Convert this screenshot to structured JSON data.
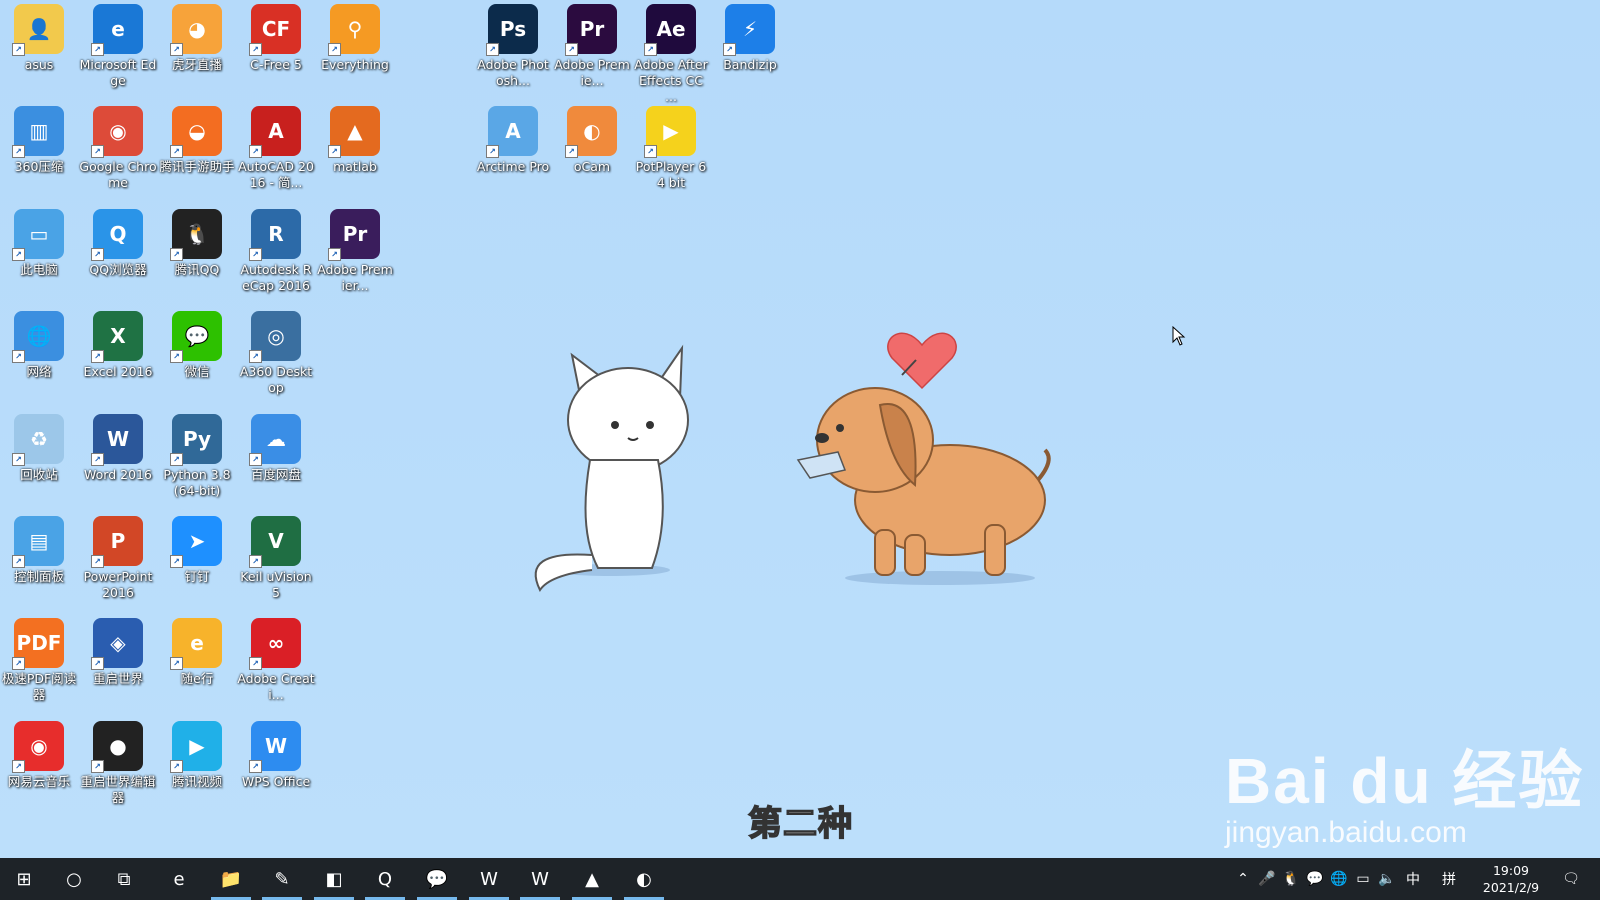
{
  "desktop": {
    "icons": [
      {
        "label": "asus",
        "glyph": "👤",
        "bg": "#f2c94c"
      },
      {
        "label": "Microsoft Edge",
        "glyph": "e",
        "bg": "#1a78d6"
      },
      {
        "label": "虎牙直播",
        "glyph": "◕",
        "bg": "#f7a33a"
      },
      {
        "label": "C-Free 5",
        "glyph": "CF",
        "bg": "#d93025"
      },
      {
        "label": "Everything",
        "glyph": "⚲",
        "bg": "#f59a23"
      },
      {
        "label": "Adobe Photosh...",
        "glyph": "Ps",
        "bg": "#0c2b4b"
      },
      {
        "label": "Adobe Premie...",
        "glyph": "Pr",
        "bg": "#2b0b3f"
      },
      {
        "label": "Adobe After Effects CC ...",
        "glyph": "Ae",
        "bg": "#1f0a3d"
      },
      {
        "label": "Bandizip",
        "glyph": "⚡",
        "bg": "#1d7fe8"
      },
      {
        "label": "360压缩",
        "glyph": "▥",
        "bg": "#3b8fe0"
      },
      {
        "label": "Google Chrome",
        "glyph": "◉",
        "bg": "#dd4b39"
      },
      {
        "label": "腾讯手游助手",
        "glyph": "◒",
        "bg": "#f36d21"
      },
      {
        "label": "AutoCAD 2016 - 简...",
        "glyph": "A",
        "bg": "#c8201e"
      },
      {
        "label": "matlab",
        "glyph": "▲",
        "bg": "#e46a1f"
      },
      {
        "label": "Arctime Pro",
        "glyph": "A",
        "bg": "#5aa7e6"
      },
      {
        "label": "oCam",
        "glyph": "◐",
        "bg": "#f08a3c"
      },
      {
        "label": "PotPlayer 64 bit",
        "glyph": "▶",
        "bg": "#f5d21c"
      },
      {
        "label": "此电脑",
        "glyph": "▭",
        "bg": "#4aa3e6"
      },
      {
        "label": "QQ浏览器",
        "glyph": "Q",
        "bg": "#2a94e8"
      },
      {
        "label": "腾讯QQ",
        "glyph": "🐧",
        "bg": "#222222"
      },
      {
        "label": "Autodesk ReCap 2016",
        "glyph": "R",
        "bg": "#2c6aa8"
      },
      {
        "label": "Adobe Premier...",
        "glyph": "Pr",
        "bg": "#3a1d5c"
      },
      {
        "label": "网络",
        "glyph": "🌐",
        "bg": "#3b8fe0"
      },
      {
        "label": "Excel 2016",
        "glyph": "X",
        "bg": "#1f7244"
      },
      {
        "label": "微信",
        "glyph": "💬",
        "bg": "#2dc100"
      },
      {
        "label": "A360 Desktop",
        "glyph": "◎",
        "bg": "#3a6fa0"
      },
      {
        "label": "回收站",
        "glyph": "♻",
        "bg": "#9cc7e9"
      },
      {
        "label": "Word 2016",
        "glyph": "W",
        "bg": "#2b579a"
      },
      {
        "label": "Python 3.8 (64-bit)",
        "glyph": "Py",
        "bg": "#306998"
      },
      {
        "label": "百度网盘",
        "glyph": "☁",
        "bg": "#3a8ee6"
      },
      {
        "label": "控制面板",
        "glyph": "▤",
        "bg": "#4aa3e6"
      },
      {
        "label": "PowerPoint 2016",
        "glyph": "P",
        "bg": "#d24726"
      },
      {
        "label": "钉钉",
        "glyph": "➤",
        "bg": "#1e90ff"
      },
      {
        "label": "Keil uVision5",
        "glyph": "V",
        "bg": "#1f6e43"
      },
      {
        "label": "极速PDF阅读器",
        "glyph": "PDF",
        "bg": "#f37021"
      },
      {
        "label": "重启世界",
        "glyph": "◈",
        "bg": "#2a5db0"
      },
      {
        "label": "随e行",
        "glyph": "e",
        "bg": "#f7b32b"
      },
      {
        "label": "Adobe Creati...",
        "glyph": "∞",
        "bg": "#da1f26"
      },
      {
        "label": "网易云音乐",
        "glyph": "◉",
        "bg": "#e72d2c"
      },
      {
        "label": "重启世界编辑器",
        "glyph": "●",
        "bg": "#222222"
      },
      {
        "label": "腾讯视频",
        "glyph": "▶",
        "bg": "#20b0e8"
      },
      {
        "label": "WPS Office",
        "glyph": "W",
        "bg": "#2d8cf0"
      }
    ],
    "caption": "第二种",
    "watermark": {
      "line1": "Bai du 经验",
      "line2": "jingyan.baidu.com"
    }
  },
  "taskbar": {
    "apps": [
      {
        "name": "start-button",
        "glyph": "⊞"
      },
      {
        "name": "search-button",
        "glyph": "○"
      },
      {
        "name": "task-view-button",
        "glyph": "⧉"
      },
      {
        "name": "edge",
        "glyph": "e"
      },
      {
        "name": "file-explorer",
        "glyph": "📁"
      },
      {
        "name": "app-pin",
        "glyph": "✎"
      },
      {
        "name": "app-note",
        "glyph": "◧"
      },
      {
        "name": "qq-browser",
        "glyph": "Q"
      },
      {
        "name": "wechat",
        "glyph": "💬"
      },
      {
        "name": "word",
        "glyph": "W"
      },
      {
        "name": "wps",
        "glyph": "W"
      },
      {
        "name": "matlab",
        "glyph": "▲"
      },
      {
        "name": "ocam",
        "glyph": "◐"
      }
    ],
    "tray": {
      "ime": "中",
      "ime2": "拼"
    },
    "clock": {
      "time": "19:09",
      "date": "2021/2/9"
    }
  }
}
